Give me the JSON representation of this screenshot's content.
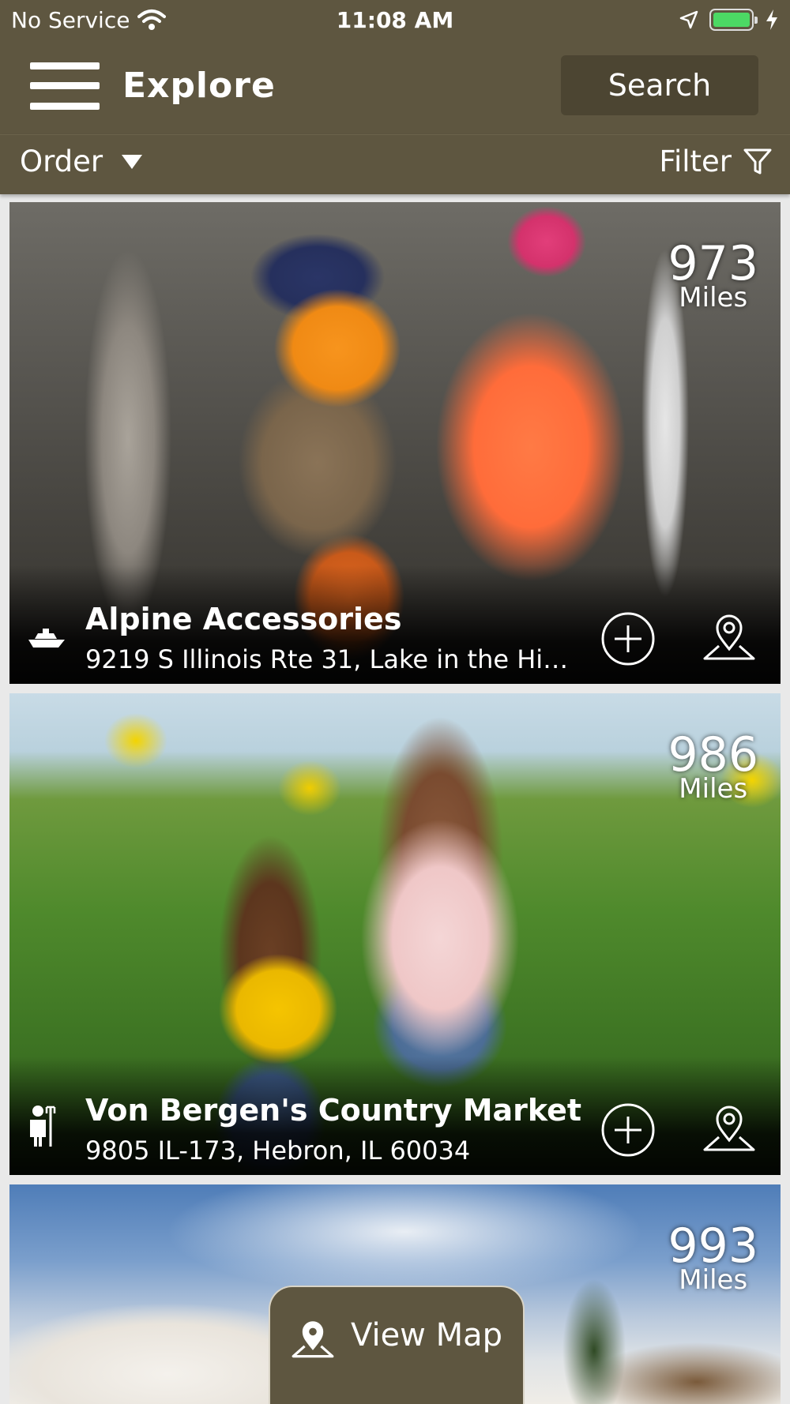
{
  "status": {
    "carrier": "No Service",
    "time": "11:08 AM",
    "battery_color": "#4cd964"
  },
  "header": {
    "title": "Explore",
    "search_label": "Search"
  },
  "toolbar": {
    "order_label": "Order",
    "filter_label": "Filter"
  },
  "listings": [
    {
      "name": "Alpine Accessories",
      "address": "9219 S Illinois Rte 31, Lake in the Hill...",
      "distance": "973",
      "unit": "Miles",
      "category_icon": "boat-icon"
    },
    {
      "name": "Von Bergen's Country Market",
      "address": "9805 IL-173, Hebron, IL 60034",
      "distance": "986",
      "unit": "Miles",
      "category_icon": "farmer-icon"
    },
    {
      "name": "",
      "address": "",
      "distance": "993",
      "unit": "Miles",
      "category_icon": ""
    }
  ],
  "view_map_label": "View Map",
  "colors": {
    "bar": "#5e5640",
    "search_button": "#4c4532"
  }
}
